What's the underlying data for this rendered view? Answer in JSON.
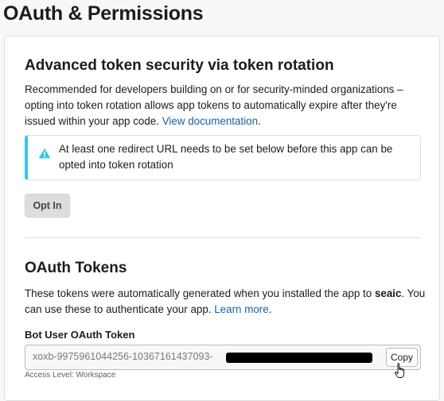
{
  "page": {
    "title": "OAuth & Permissions"
  },
  "token_rotation": {
    "title": "Advanced token security via token rotation",
    "description": "Recommended for developers building on or for security-minded organizations – opting into token rotation allows app tokens to automatically expire after they're issued within your app code.",
    "doc_link": "View documentation",
    "doc_link_suffix": ".",
    "notice": {
      "icon": "warning-icon",
      "text": "At least one redirect URL needs to be set below before this app can be opted into token rotation"
    },
    "opt_in_label": "Opt In"
  },
  "oauth_tokens": {
    "title": "OAuth Tokens",
    "description_before": "These tokens were automatically generated when you installed the app to ",
    "workspace": "seaic",
    "description_after": ". You can use these to authenticate your app. ",
    "learn_more": "Learn more",
    "learn_more_suffix": ".",
    "bot_token": {
      "label": "Bot User OAuth Token",
      "value_visible": "xoxb-9975961044256-10367161437093-",
      "copy_label": "Copy",
      "access_level": "Access Level: Workspace"
    }
  },
  "colors": {
    "accent": "#1264a3",
    "notice_border": "#36c5f0",
    "warning_icon": "#36c5f0"
  }
}
